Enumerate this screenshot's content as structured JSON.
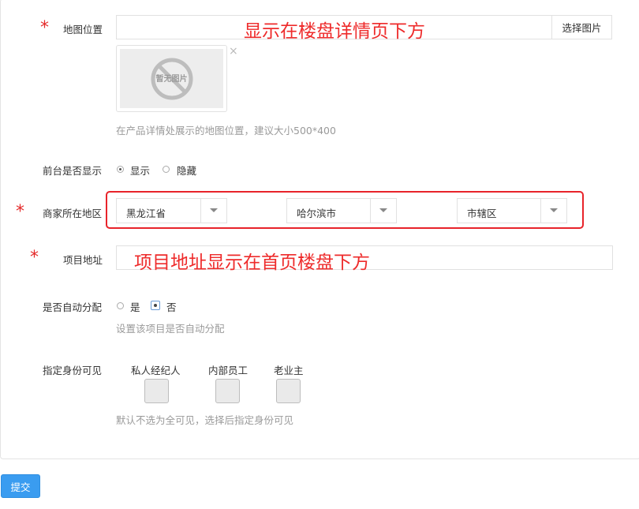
{
  "map": {
    "label": "地图位置",
    "annotation": "显示在楼盘详情页下方",
    "pick_button": "选择图片",
    "thumb_placeholder": "暂无图片",
    "remove_icon": "×",
    "hint": "在产品详情处展示的地图位置，建议大小500*400"
  },
  "frontend_display": {
    "label": "前台是否显示",
    "options": [
      {
        "label": "显示",
        "checked": true
      },
      {
        "label": "隐藏",
        "checked": false
      }
    ]
  },
  "region": {
    "label": "商家所在地区",
    "province": "黑龙江省",
    "city": "哈尔滨市",
    "district": "市辖区"
  },
  "address": {
    "label": "项目地址",
    "annotation": "项目地址显示在首页楼盘下方"
  },
  "auto_assign": {
    "label": "是否自动分配",
    "options": [
      {
        "label": "是",
        "checked": false
      },
      {
        "label": "否",
        "checked": true
      }
    ],
    "hint": "设置该项目是否自动分配"
  },
  "visibility": {
    "label": "指定身份可见",
    "roles": [
      "私人经纪人",
      "内部员工",
      "老业主"
    ],
    "hint": "默认不选为全可见，选择后指定身份可见"
  },
  "required_mark": "*",
  "submit_label": "提交",
  "colors": {
    "required": "#e42a2a",
    "annotation": "#ee2b2b",
    "primary_button": "#3a9cf0"
  }
}
